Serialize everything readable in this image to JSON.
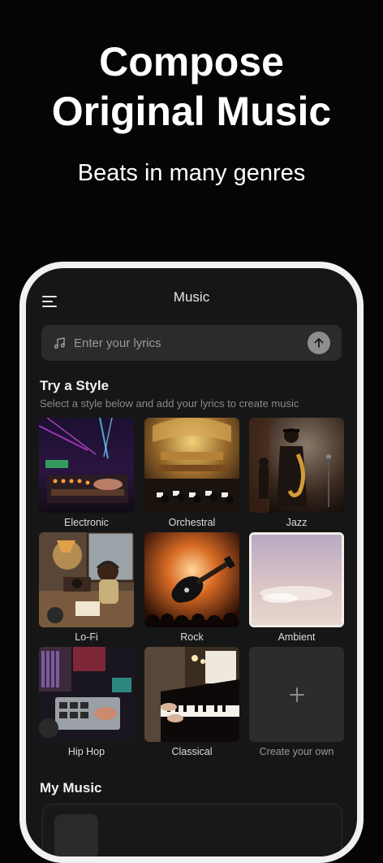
{
  "hero": {
    "title_line1": "Compose",
    "title_line2": "Original Music",
    "subtitle": "Beats in many genres"
  },
  "app": {
    "title": "Music",
    "lyrics_placeholder": "Enter your lyrics"
  },
  "styles_section": {
    "title": "Try a Style",
    "subtitle": "Select a style below and add your lyrics to create music",
    "items": [
      {
        "label": "Electronic"
      },
      {
        "label": "Orchestral"
      },
      {
        "label": "Jazz"
      },
      {
        "label": "Lo-Fi"
      },
      {
        "label": "Rock"
      },
      {
        "label": "Ambient"
      },
      {
        "label": "Hip Hop"
      },
      {
        "label": "Classical"
      }
    ],
    "create_label": "Create your own",
    "create_symbol": "+"
  },
  "my_music": {
    "title": "My Music"
  }
}
